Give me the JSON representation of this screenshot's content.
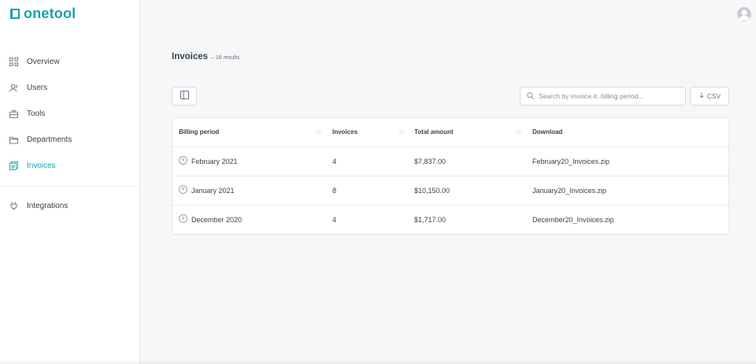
{
  "app": {
    "logo_text": "onetool",
    "accent": "#17a2a7"
  },
  "sidebar": {
    "items": [
      {
        "label": "Overview",
        "icon": "grid-icon",
        "active": false
      },
      {
        "label": "Users",
        "icon": "users-icon",
        "active": false
      },
      {
        "label": "Tools",
        "icon": "briefcase-icon",
        "active": false
      },
      {
        "label": "Departments",
        "icon": "folder-icon",
        "active": false
      },
      {
        "label": "Invoices",
        "icon": "invoice-icon",
        "active": true
      }
    ],
    "bottom_items": [
      {
        "label": "Integrations",
        "icon": "plug-icon",
        "active": false
      }
    ]
  },
  "header": {
    "avatar_icon": "user-avatar-icon"
  },
  "main": {
    "title": "Invoices",
    "subtitle": "– 16 results",
    "search": {
      "placeholder": "Search by invoice #, billing period..."
    },
    "csv_label": "CSV",
    "columns": [
      "Billing period",
      "Invoices",
      "Total amount",
      "Download"
    ],
    "rows": [
      {
        "period": "February 2021",
        "invoices": "4",
        "amount": "$7,837.00",
        "download": "February20_Invoices.zip"
      },
      {
        "period": "January 2021",
        "invoices": "8",
        "amount": "$10,150.00",
        "download": "January20_Invoices.zip"
      },
      {
        "period": "December 2020",
        "invoices": "4",
        "amount": "$1,717.00",
        "download": "December20_Invoices.zip"
      }
    ]
  }
}
